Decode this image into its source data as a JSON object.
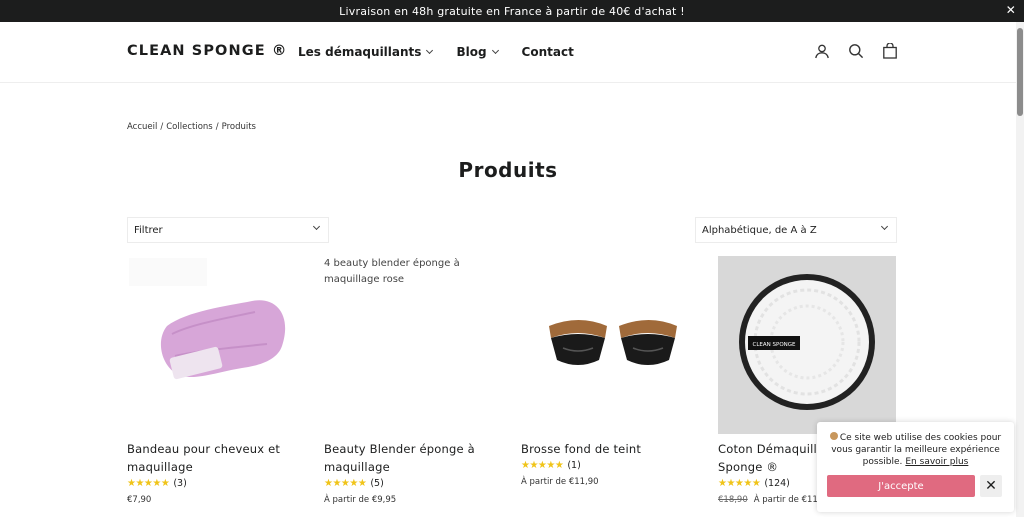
{
  "announcement": {
    "text": "Livraison en 48h gratuite en France à partir de 40€ d'achat !",
    "close": "✕"
  },
  "header": {
    "logo": "CLEAN SPONGE ®",
    "nav": [
      {
        "label": "Les démaquillants"
      },
      {
        "label": "Blog"
      },
      {
        "label": "Contact"
      }
    ],
    "icons": [
      "account-icon",
      "search-icon",
      "cart-icon"
    ]
  },
  "breadcrumb": [
    "Accueil",
    "/",
    "Collections",
    "/",
    "Produits"
  ],
  "page_title": "Produits",
  "filter": {
    "label": "Filtrer"
  },
  "sort": {
    "label": "Alphabétique, de A à Z"
  },
  "products": [
    {
      "name": "Bandeau pour cheveux et maquillage",
      "stars": "★★★★★",
      "reviews": "(3)",
      "price": "€7,90"
    },
    {
      "name": "Beauty Blender éponge à maquillage",
      "alt": "4 beauty blender éponge à maquillage rose",
      "stars": "★★★★★",
      "reviews": "(5)",
      "price": "À partir de €9,95"
    },
    {
      "name": "Brosse fond de teint",
      "stars": "★★★★★",
      "reviews": "(1)",
      "price": "À partir de €11,90"
    },
    {
      "name": "Coton Démaquillant Clean Sponge ®",
      "pad_label": "CLEAN SPONGE",
      "stars": "★★★★★",
      "reviews": "(124)",
      "old_price": "€18,90",
      "price": "À partir de €11,..."
    }
  ],
  "cookie": {
    "message": "Ce site web utilise des cookies pour vous garantir la meilleure expérience possible.",
    "link": "En savoir plus",
    "accept": "J'accepte",
    "close": "✕"
  },
  "colors": {
    "announcement_bg": "#1c1d1d",
    "accept_bg": "#e06a80",
    "star": "#f0c419",
    "headband": "#d7a6d8"
  }
}
